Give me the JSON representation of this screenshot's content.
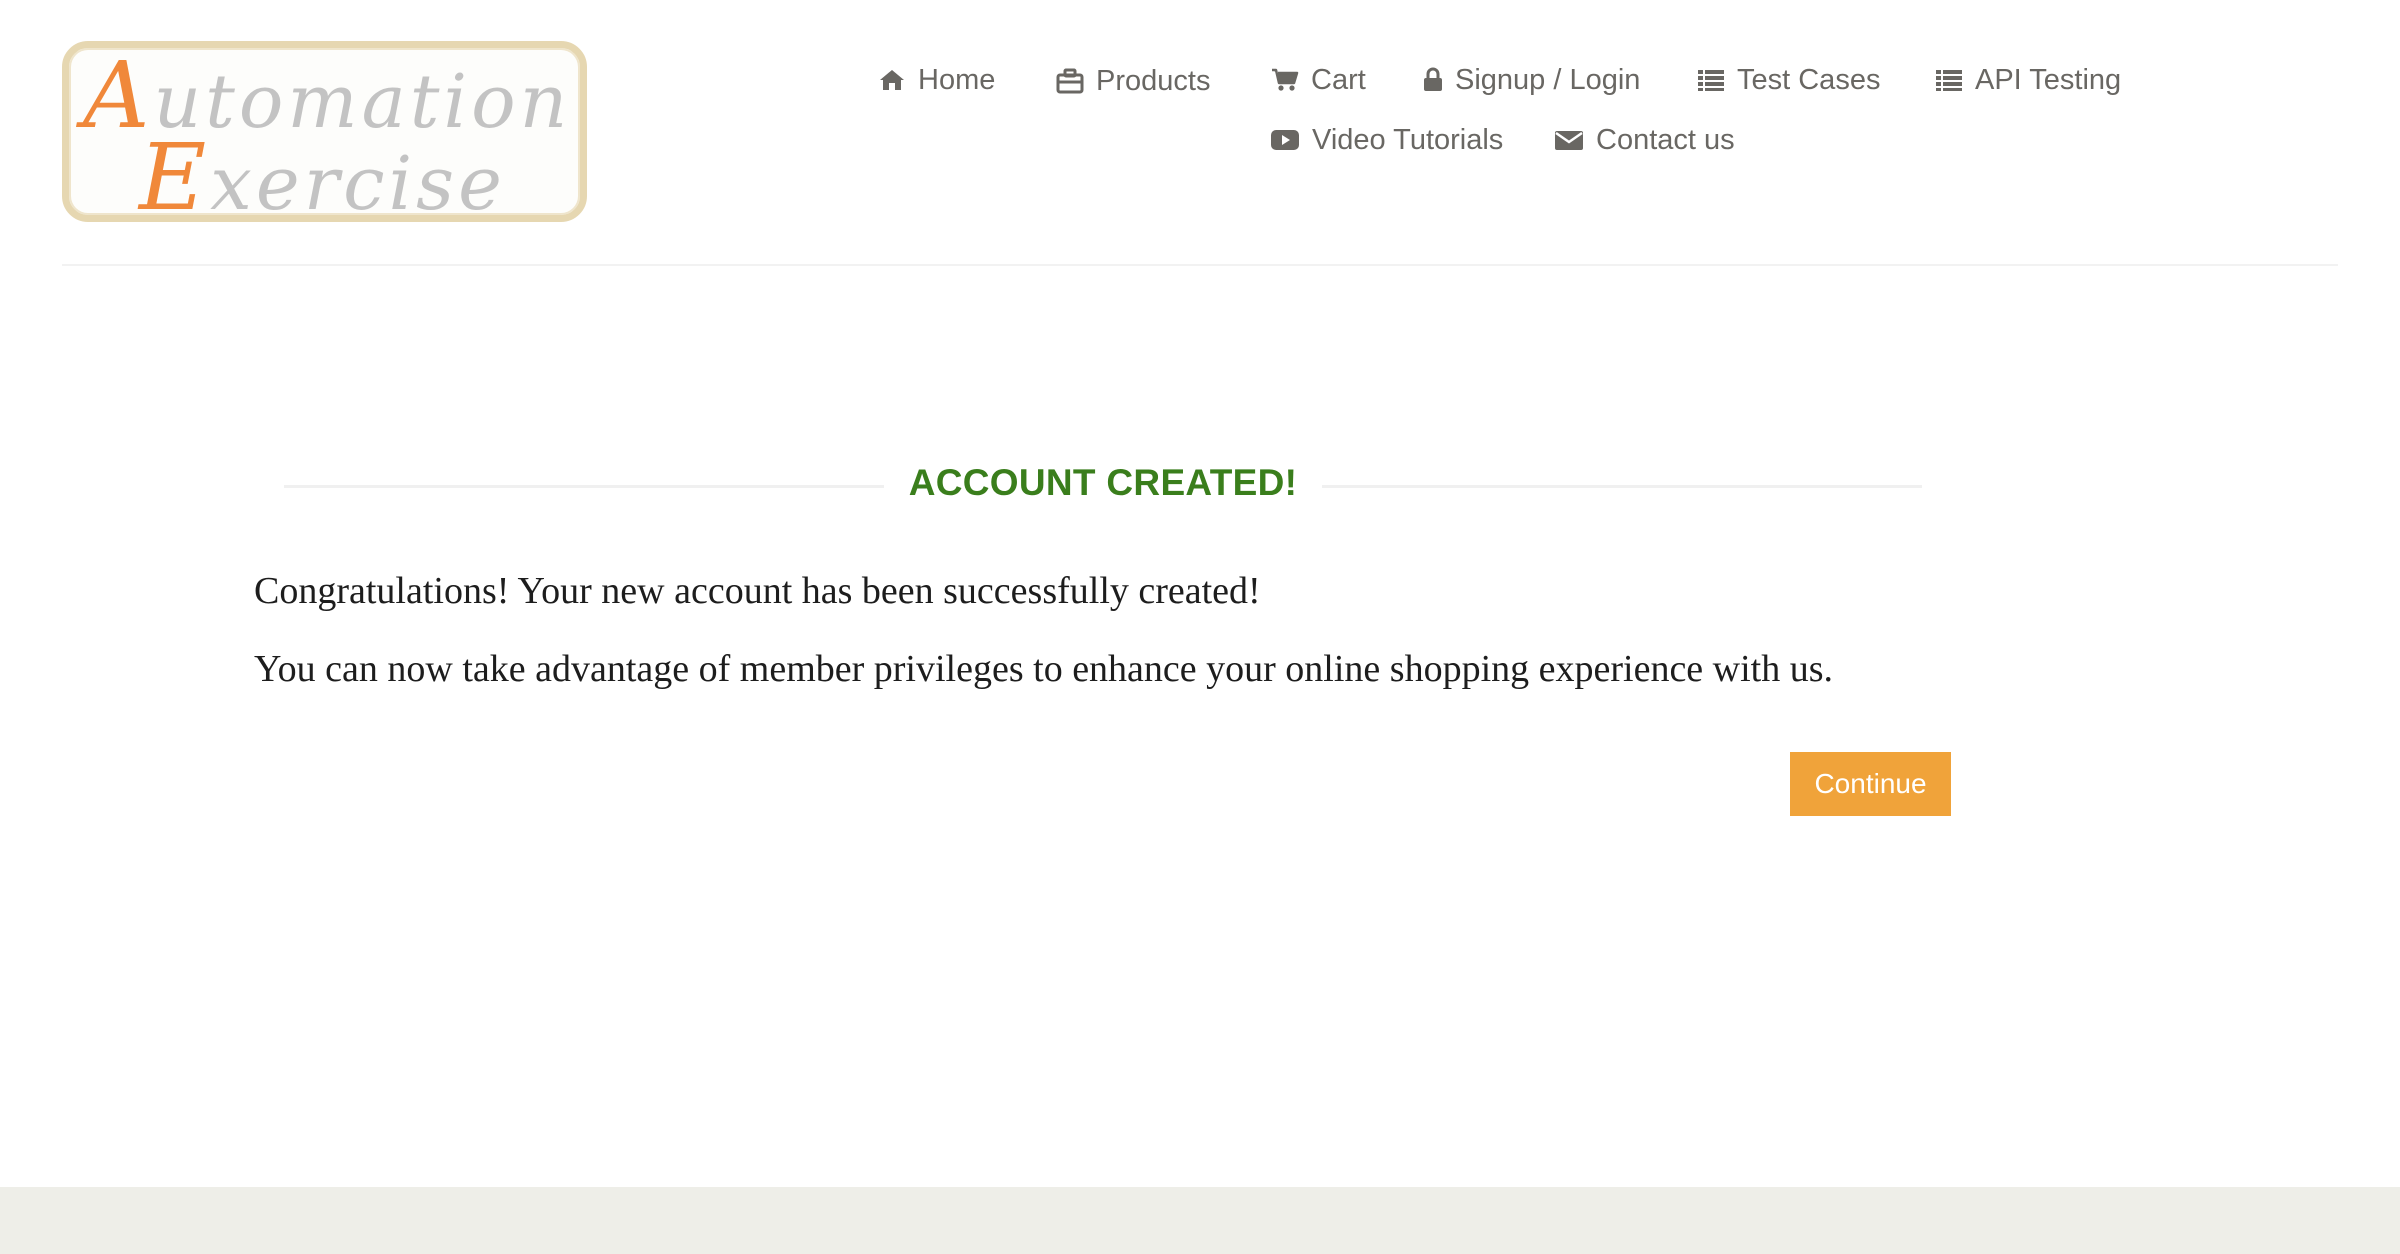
{
  "logo": {
    "line1_cap": "A",
    "line1_rest": "utomation",
    "line2_cap": "E",
    "line2_rest": "xercise",
    "accent_color": "#f0883a",
    "letter_color": "#c3c3c3"
  },
  "nav": {
    "items": [
      {
        "label": "Home",
        "icon": "home-icon"
      },
      {
        "label": "Products",
        "icon": "briefcase-icon"
      },
      {
        "label": "Cart",
        "icon": "cart-icon"
      },
      {
        "label": "Signup / Login",
        "icon": "lock-icon"
      },
      {
        "label": "Test Cases",
        "icon": "list-icon"
      },
      {
        "label": "API Testing",
        "icon": "list-icon"
      },
      {
        "label": "Video Tutorials",
        "icon": "youtube-play-icon"
      },
      {
        "label": "Contact us",
        "icon": "envelope-icon"
      }
    ],
    "text_color": "#696763"
  },
  "main": {
    "title": "ACCOUNT CREATED!",
    "title_color": "#3a7e1c",
    "message_1": "Congratulations! Your new account has been successfully created!",
    "message_2": "You can now take advantage of member privileges to enhance your online shopping experience with us.",
    "continue_label": "Continue",
    "button_color": "#f0a33a"
  },
  "footer": {
    "band_color": "#eeeee8"
  }
}
